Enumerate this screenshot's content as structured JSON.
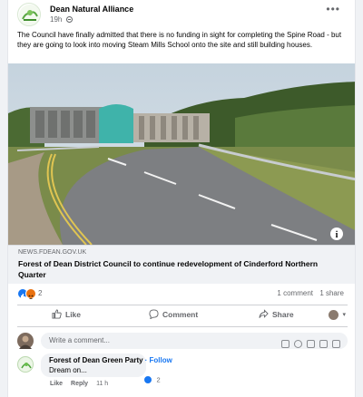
{
  "post": {
    "page_name": "Dean Natural Alliance",
    "time": "19h",
    "more_icon": "ellipsis-icon",
    "text": "The Council have finally admitted that there is no funding in sight for completing the Spine Road - but they are going to look into moving Steam Mills School onto the site and still building houses."
  },
  "link": {
    "domain": "NEWS.FDEAN.GOV.UK",
    "title": "Forest of Dean District Council to continue redevelopment of Cinderford Northern Quarter",
    "info_icon": "info-icon"
  },
  "stats": {
    "reaction_count": "2",
    "comments": "1 comment",
    "shares": "1 share"
  },
  "actions": {
    "like": "Like",
    "comment": "Comment",
    "share": "Share"
  },
  "composer": {
    "placeholder": "Write a comment..."
  },
  "comment": {
    "author": "Forest of Dean Green Party",
    "follow": "· Follow",
    "text": "Dream on...",
    "reaction_count": "2",
    "like": "Like",
    "reply": "Reply",
    "time": "11 h"
  },
  "colors": {
    "accent": "#1877f2",
    "angry": "#e9710f",
    "muted": "#65676b"
  }
}
